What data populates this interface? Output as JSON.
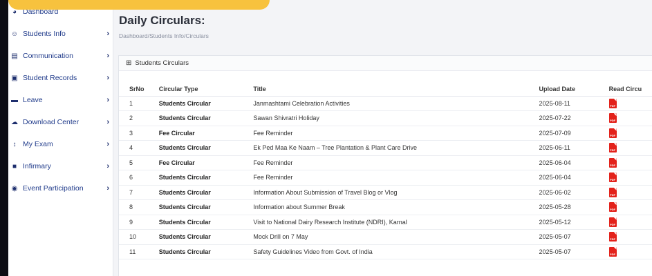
{
  "sidebar": {
    "items": [
      {
        "label": "Dashboard",
        "icon": "dashboard-icon",
        "glyph": "◕",
        "chevron": ""
      },
      {
        "label": "Students Info",
        "icon": "user-plus-icon",
        "glyph": "☺",
        "chevron": "›"
      },
      {
        "label": "Communication",
        "icon": "building-icon",
        "glyph": "▤",
        "chevron": "›"
      },
      {
        "label": "Student Records",
        "icon": "printer-icon",
        "glyph": "▣",
        "chevron": "›"
      },
      {
        "label": "Leave",
        "icon": "book-icon",
        "glyph": "▬",
        "chevron": "›"
      },
      {
        "label": "Download Center",
        "icon": "cloud-download-icon",
        "glyph": "☁",
        "chevron": "›"
      },
      {
        "label": "My Exam",
        "icon": "sort-icon",
        "glyph": "↕",
        "chevron": "›"
      },
      {
        "label": "Infirmary",
        "icon": "briefcase-icon",
        "glyph": "■",
        "chevron": "›"
      },
      {
        "label": "Event Participation",
        "icon": "circle-icon",
        "glyph": "◉",
        "chevron": "›"
      }
    ]
  },
  "header": {
    "title": "Daily Circulars:",
    "breadcrumb": "Dashboard/Students Info/Circulars"
  },
  "panel": {
    "icon_glyph": "⊞",
    "title": "Students Circulars",
    "columns": [
      "SrNo",
      "Circular Type",
      "Title",
      "Upload Date",
      "Read Circu"
    ],
    "pdf_label": "PDF",
    "rows": [
      {
        "sr": "1",
        "type": "Students Circular",
        "title": "Janmashtami Celebration Activities",
        "date": "2025-08-11"
      },
      {
        "sr": "2",
        "type": "Students Circular",
        "title": "Sawan Shivratri Holiday",
        "date": "2025-07-22"
      },
      {
        "sr": "3",
        "type": "Fee Circular",
        "title": "Fee Reminder",
        "date": "2025-07-09"
      },
      {
        "sr": "4",
        "type": "Students Circular",
        "title": "Ek Ped Maa Ke Naam – Tree Plantation & Plant Care Drive",
        "date": "2025-06-11"
      },
      {
        "sr": "5",
        "type": "Fee Circular",
        "title": "Fee Reminder",
        "date": "2025-06-04"
      },
      {
        "sr": "6",
        "type": "Students Circular",
        "title": "Fee Reminder",
        "date": "2025-06-04"
      },
      {
        "sr": "7",
        "type": "Students Circular",
        "title": "Information About Submission of Travel Blog or Vlog",
        "date": "2025-06-02"
      },
      {
        "sr": "8",
        "type": "Students Circular",
        "title": "Information about Summer Break",
        "date": "2025-05-28"
      },
      {
        "sr": "9",
        "type": "Students Circular",
        "title": "Visit to National Dairy Research Institute (NDRI), Karnal",
        "date": "2025-05-12"
      },
      {
        "sr": "10",
        "type": "Students Circular",
        "title": "Mock Drill on 7 May",
        "date": "2025-05-07"
      },
      {
        "sr": "11",
        "type": "Students Circular",
        "title": "Safety Guidelines Video from Govt. of India",
        "date": "2025-05-07"
      }
    ]
  },
  "colors": {
    "accent": "#1f3a8a",
    "pdf": "#e3221b",
    "banner": "#f7c23e"
  }
}
